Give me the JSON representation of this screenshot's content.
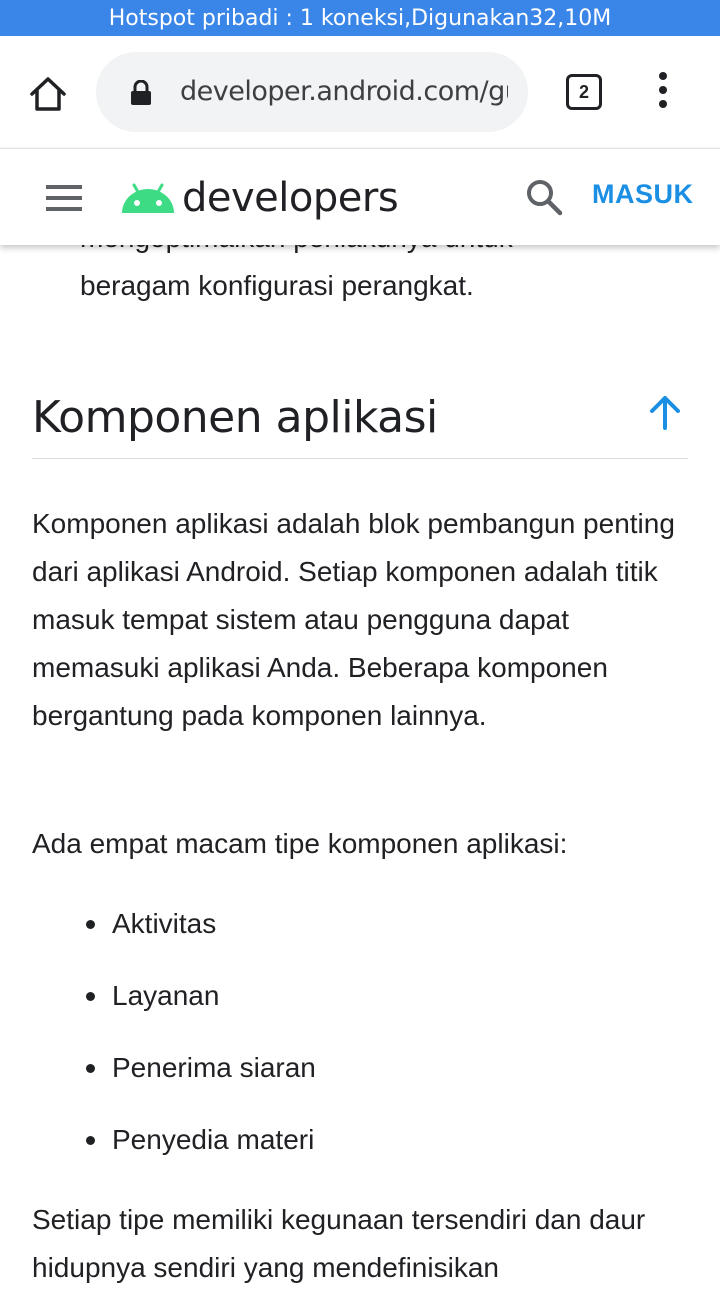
{
  "status": {
    "hotspot_text": "Hotspot pribadi : 1 koneksi,Digunakan32,10M"
  },
  "browser": {
    "url": "developer.android.com/guide/components/fundamentals",
    "tab_count": "2"
  },
  "site": {
    "logo_text": "developers",
    "signin_label": "MASUK",
    "accent_color": "#1a8fe3",
    "android_green": "#3ddc84"
  },
  "content": {
    "partial_line_1": "mengoptimalkan perilakunya untuk",
    "partial_line_2": "beragam konfigurasi perangkat.",
    "heading": "Komponen aplikasi",
    "paragraph_1": "Komponen aplikasi adalah blok pembangun penting dari aplikasi Android. Setiap komponen adalah titik masuk tempat sistem atau pengguna dapat memasuki aplikasi Anda. Beberapa komponen bergantung pada komponen lainnya.",
    "paragraph_2": "Ada empat macam tipe komponen aplikasi:",
    "bullets": [
      "Aktivitas",
      "Layanan",
      "Penerima siaran",
      "Penyedia materi"
    ],
    "paragraph_3": "Setiap tipe memiliki kegunaan tersendiri dan daur hidupnya sendiri yang mendefinisikan"
  }
}
